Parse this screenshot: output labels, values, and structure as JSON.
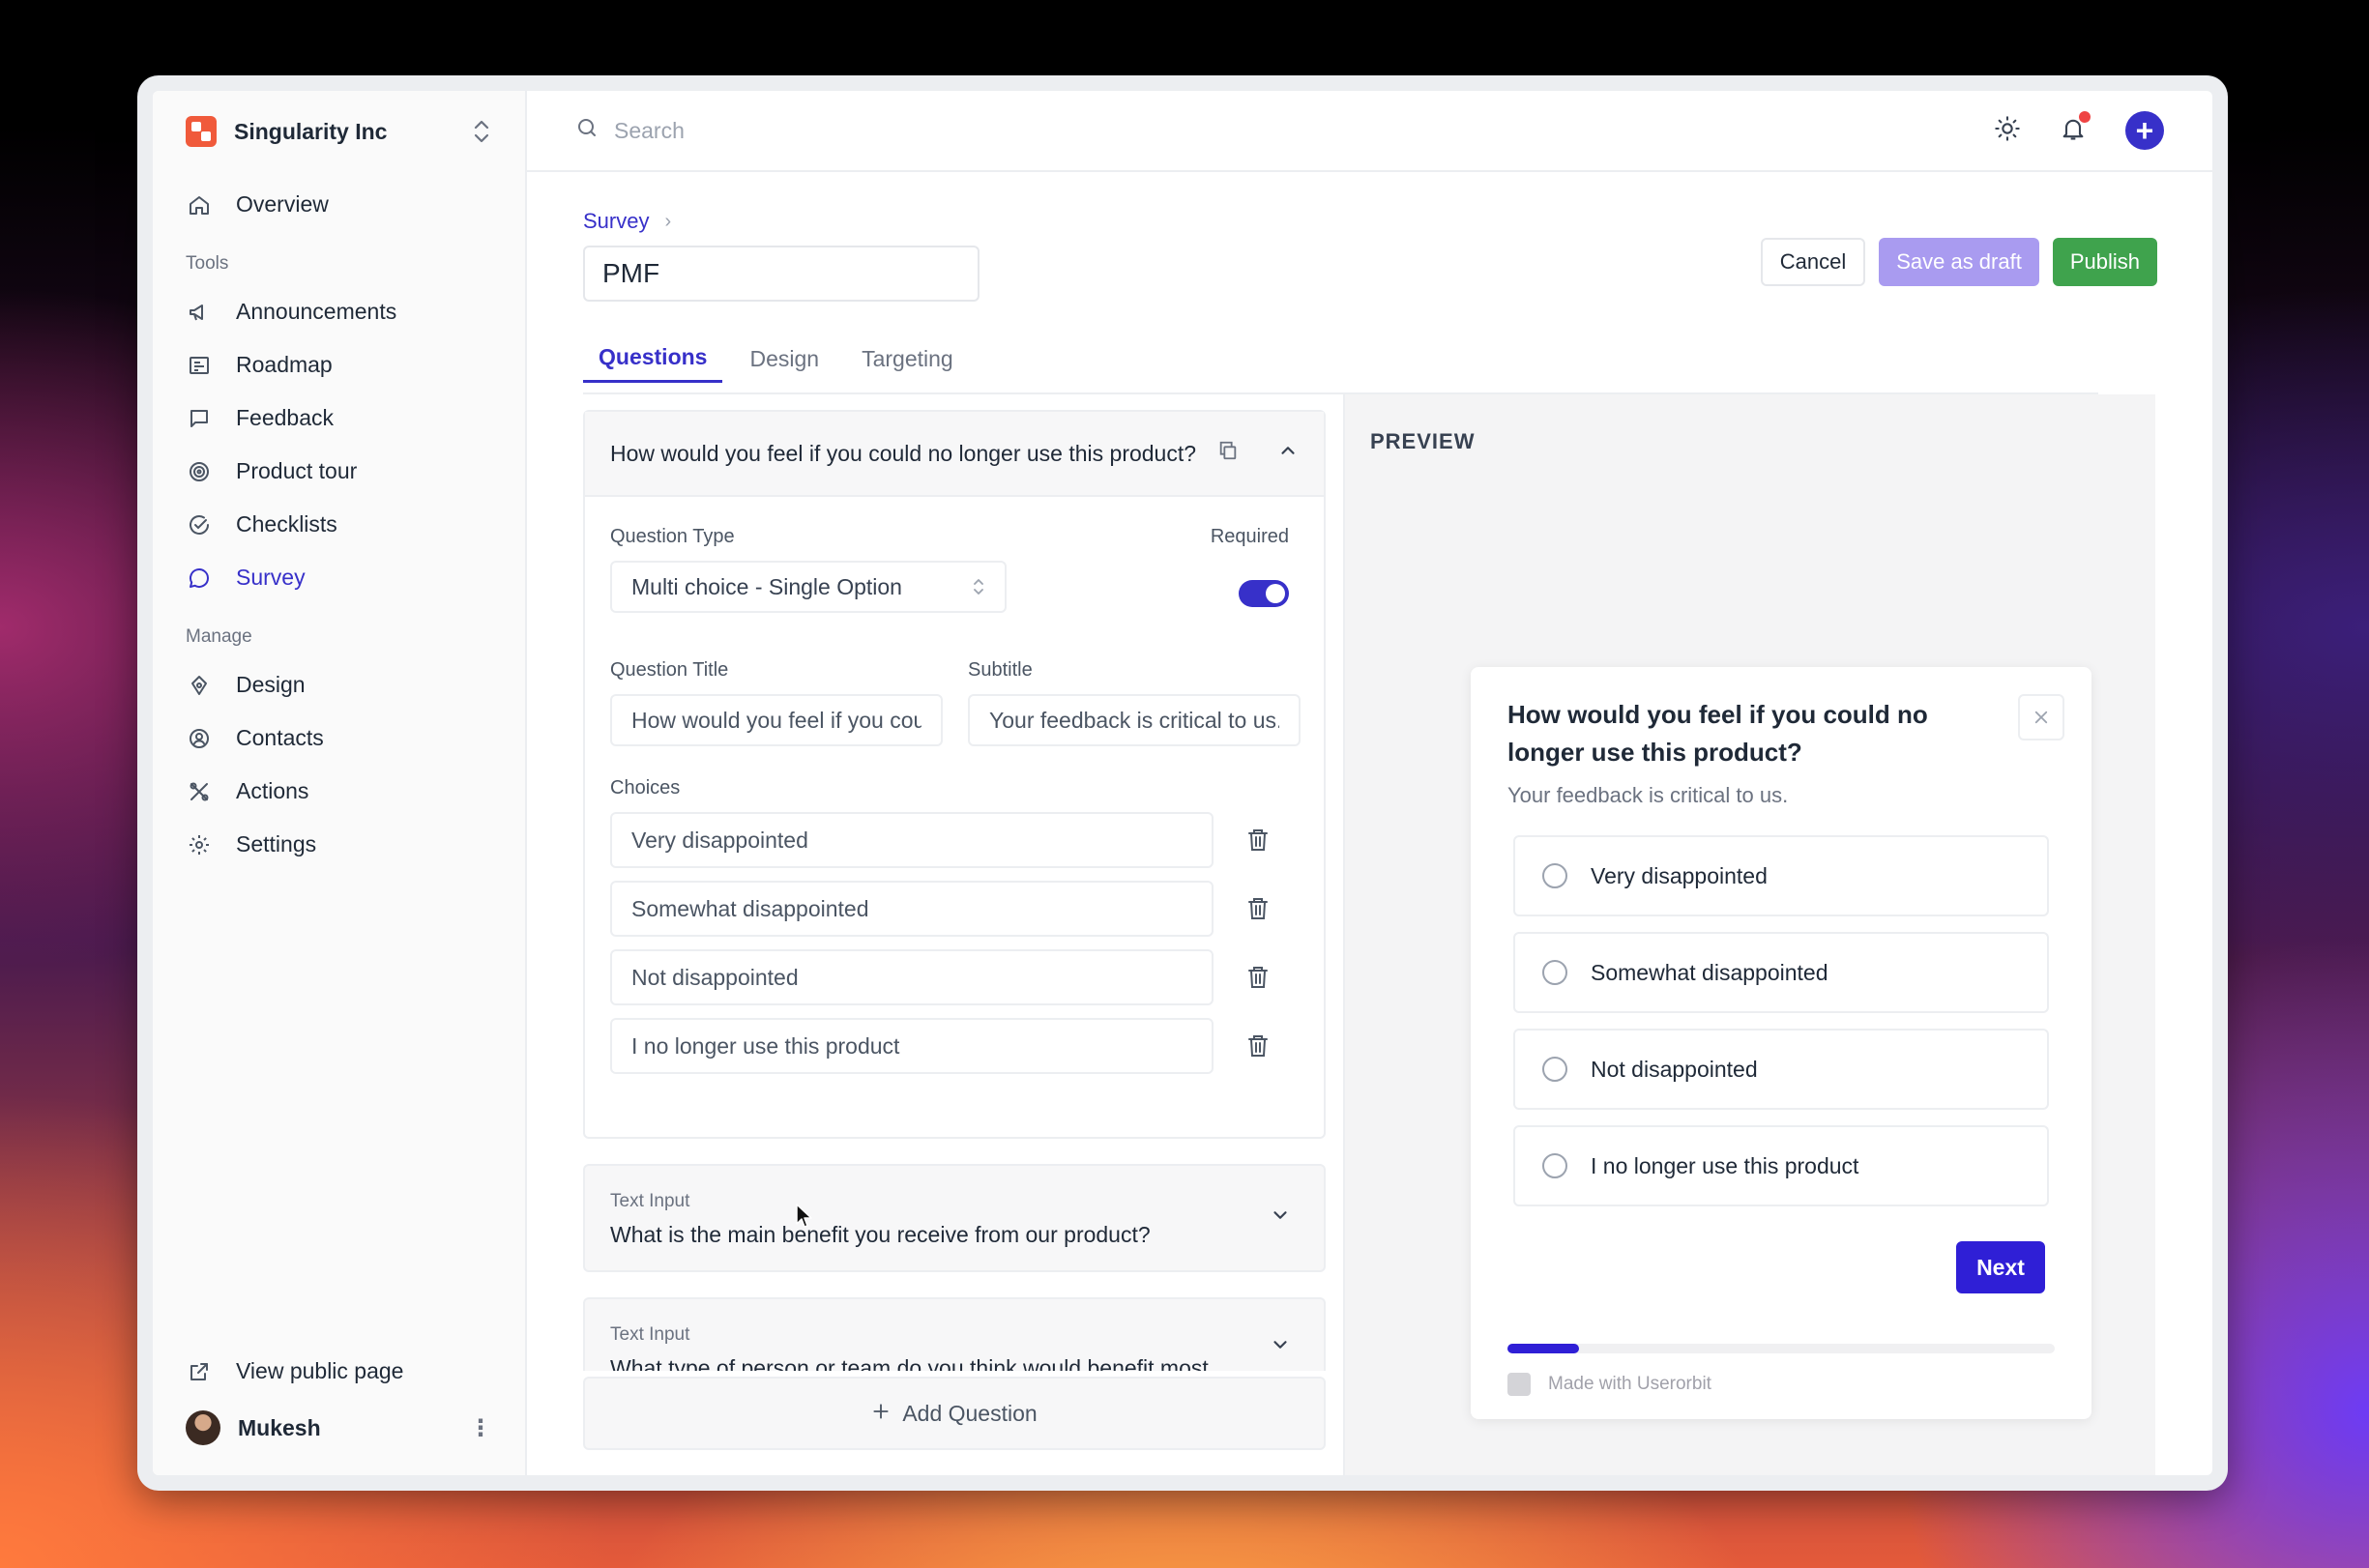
{
  "org": {
    "name": "Singularity Inc"
  },
  "sidebar": {
    "overview": "Overview",
    "tools_label": "Tools",
    "tools": [
      {
        "label": "Announcements",
        "icon": "megaphone-icon"
      },
      {
        "label": "Roadmap",
        "icon": "roadmap-icon"
      },
      {
        "label": "Feedback",
        "icon": "message-icon"
      },
      {
        "label": "Product tour",
        "icon": "target-icon"
      },
      {
        "label": "Checklists",
        "icon": "check-circle-icon"
      },
      {
        "label": "Survey",
        "icon": "chat-icon",
        "active": true
      }
    ],
    "manage_label": "Manage",
    "manage": [
      {
        "label": "Design",
        "icon": "paint-icon"
      },
      {
        "label": "Contacts",
        "icon": "contacts-icon"
      },
      {
        "label": "Actions",
        "icon": "actions-icon"
      },
      {
        "label": "Settings",
        "icon": "gear-icon"
      }
    ],
    "view_public": "View public page",
    "user_name": "Mukesh"
  },
  "topbar": {
    "search_placeholder": "Search"
  },
  "page": {
    "breadcrumb": "Survey",
    "title_value": "PMF",
    "cancel": "Cancel",
    "save_draft": "Save as draft",
    "publish": "Publish"
  },
  "tabs": [
    "Questions",
    "Design",
    "Targeting"
  ],
  "editor": {
    "question_header": "How would you feel if you could no longer use this product?",
    "question_type_label": "Question Type",
    "question_type_value": "Multi choice - Single Option",
    "required_label": "Required",
    "question_title_label": "Question Title",
    "question_title_value": "How would you feel if you could no longer use this product?",
    "subtitle_label": "Subtitle",
    "subtitle_value": "Your feedback is critical to us.",
    "choices_label": "Choices",
    "choices": [
      "Very disappointed",
      "Somewhat disappointed",
      "Not disappointed",
      "I no longer use this product"
    ],
    "collapsed": [
      {
        "type": "Text Input",
        "question": "What is the main benefit you receive from our product?"
      },
      {
        "type": "Text Input",
        "question": "What type of person or team do you think would benefit most"
      }
    ],
    "add_question": "Add Question"
  },
  "preview": {
    "label": "PREVIEW",
    "title": "How would you feel if you could no longer use this product?",
    "subtitle": "Your feedback is critical to us.",
    "options": [
      "Very disappointed",
      "Somewhat disappointed",
      "Not disappointed",
      "I no longer use this product"
    ],
    "next": "Next",
    "progress_percent": 13,
    "made_with": "Made with Userorbit"
  },
  "colors": {
    "accent": "#3730c9",
    "publish": "#3fa34d",
    "draft": "#a99bf0"
  }
}
